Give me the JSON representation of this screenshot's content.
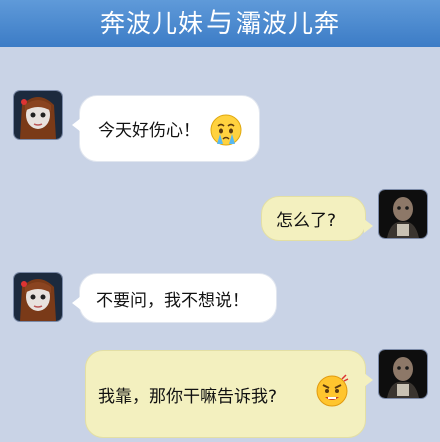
{
  "header": {
    "name_left": "奔波儿妹",
    "connector": "与",
    "name_right": "灞波儿奔"
  },
  "messages": [
    {
      "sender": "left",
      "text": "今天好伤心！",
      "emoji": "crying-face-icon"
    },
    {
      "sender": "right",
      "text": "怎么了?"
    },
    {
      "sender": "left",
      "text": "不要问，我不想说！"
    },
    {
      "sender": "right",
      "text": "我靠，那你干嘛告诉我?",
      "emoji": "angry-face-icon"
    }
  ],
  "colors": {
    "header_blue": "#4a8ad2",
    "background": "#c9d3e6",
    "incoming_bubble": "#ffffff",
    "outgoing_bubble": "#f3f0bf"
  }
}
